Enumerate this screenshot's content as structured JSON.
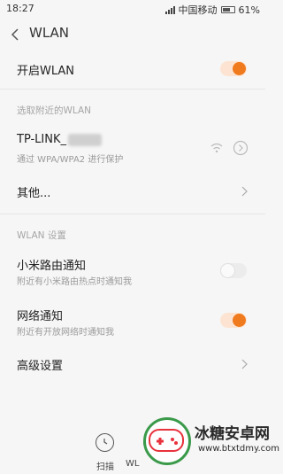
{
  "status_bar": {
    "time": "18:27",
    "carrier": "中国移动",
    "battery": "61%"
  },
  "header": {
    "title": "WLAN"
  },
  "wlan_toggle": {
    "label": "开启WLAN",
    "on": true
  },
  "nearby_section": {
    "header": "选取附近的WLAN"
  },
  "network": {
    "ssid": "TP-LINK_",
    "security": "通过 WPA/WPA2 进行保护",
    "icons": [
      "wifi-signal-icon",
      "info-icon"
    ]
  },
  "other": {
    "label": "其他..."
  },
  "wlan_settings_section": {
    "header": "WLAN 设置"
  },
  "router_notify": {
    "label": "小米路由通知",
    "sub": "附近有小米路由热点时通知我",
    "on": false
  },
  "network_notify": {
    "label": "网络通知",
    "sub": "附近有开放网络时通知我",
    "on": true
  },
  "advanced": {
    "label": "高级设置"
  },
  "bottom_bar": {
    "scan_label": "扫描",
    "wlan_label": "WL"
  },
  "watermark": {
    "text": "冰糖安卓网",
    "url": "www.btxtdmy.com"
  },
  "colors": {
    "accent": "#f07a1e",
    "background": "#f6f6f6",
    "secondary_text": "#9a9a9a"
  }
}
